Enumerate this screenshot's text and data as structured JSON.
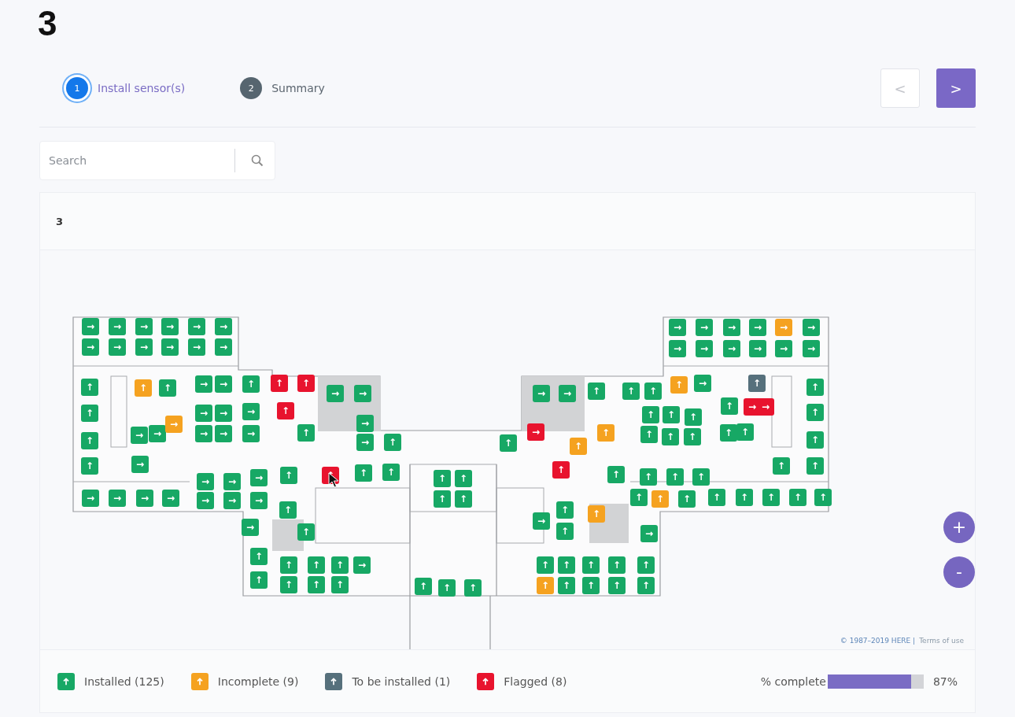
{
  "page_title": "3",
  "steps": [
    {
      "number": "1",
      "label": "Install sensor(s)",
      "selected": true
    },
    {
      "number": "2",
      "label": "Summary",
      "selected": false
    }
  ],
  "nav": {
    "prev": {
      "glyph": "<",
      "disabled": true
    },
    "next": {
      "glyph": ">",
      "disabled": false
    }
  },
  "search": {
    "placeholder": "Search"
  },
  "floor": {
    "title": "3"
  },
  "map": {
    "markers": [
      {
        "kind": "installed",
        "glyph": "→"
      },
      {
        "kind": "installed",
        "glyph": "→"
      },
      {
        "kind": "installed",
        "glyph": "→"
      },
      {
        "kind": "installed",
        "glyph": "→"
      },
      {
        "kind": "installed",
        "glyph": "→"
      },
      {
        "kind": "installed",
        "glyph": "→"
      },
      {
        "kind": "installed",
        "glyph": "→"
      },
      {
        "kind": "installed",
        "glyph": "→"
      },
      {
        "kind": "installed",
        "glyph": "→"
      },
      {
        "kind": "installed",
        "glyph": "→"
      },
      {
        "kind": "installed",
        "glyph": "→"
      },
      {
        "kind": "installed",
        "glyph": "→"
      },
      {
        "kind": "installed",
        "glyph": "↑"
      },
      {
        "kind": "installed",
        "glyph": "↑"
      },
      {
        "kind": "installed",
        "glyph": "↑"
      },
      {
        "kind": "installed",
        "glyph": "↑"
      },
      {
        "kind": "incomplete",
        "glyph": "↑"
      },
      {
        "kind": "installed",
        "glyph": "↑"
      },
      {
        "kind": "installed",
        "glyph": "→"
      },
      {
        "kind": "installed",
        "glyph": "→"
      },
      {
        "kind": "incomplete",
        "glyph": "→"
      },
      {
        "kind": "installed",
        "glyph": "→"
      },
      {
        "kind": "installed",
        "glyph": "→"
      },
      {
        "kind": "installed",
        "glyph": "→"
      },
      {
        "kind": "installed",
        "glyph": "→"
      },
      {
        "kind": "installed",
        "glyph": "→"
      },
      {
        "kind": "installed",
        "glyph": "→"
      },
      {
        "kind": "installed",
        "glyph": "→"
      },
      {
        "kind": "installed",
        "glyph": "↑"
      },
      {
        "kind": "installed",
        "glyph": "→"
      },
      {
        "kind": "installed",
        "glyph": "→"
      },
      {
        "kind": "installed",
        "glyph": "→"
      },
      {
        "kind": "installed",
        "glyph": "→"
      },
      {
        "kind": "installed",
        "glyph": "→"
      },
      {
        "kind": "installed",
        "glyph": "→"
      },
      {
        "kind": "flagged",
        "glyph": "↑"
      },
      {
        "kind": "flagged",
        "glyph": "↑"
      },
      {
        "kind": "flagged",
        "glyph": "↑"
      },
      {
        "kind": "installed",
        "glyph": "↑"
      },
      {
        "kind": "installed",
        "glyph": "→"
      },
      {
        "kind": "installed",
        "glyph": "→"
      },
      {
        "kind": "installed",
        "glyph": "→"
      },
      {
        "kind": "installed",
        "glyph": "→"
      },
      {
        "kind": "installed",
        "glyph": "↑"
      },
      {
        "kind": "installed",
        "glyph": "→"
      },
      {
        "kind": "installed",
        "glyph": "→"
      },
      {
        "kind": "installed",
        "glyph": "→"
      },
      {
        "kind": "installed",
        "glyph": "→"
      },
      {
        "kind": "installed",
        "glyph": "→"
      },
      {
        "kind": "installed",
        "glyph": "→"
      },
      {
        "kind": "installed",
        "glyph": "↑"
      },
      {
        "kind": "flagged",
        "glyph": "↑"
      },
      {
        "kind": "installed",
        "glyph": "↑"
      },
      {
        "kind": "installed",
        "glyph": "↑"
      },
      {
        "kind": "installed",
        "glyph": "↑"
      },
      {
        "kind": "installed",
        "glyph": "→"
      },
      {
        "kind": "installed",
        "glyph": "↑"
      },
      {
        "kind": "installed",
        "glyph": "↑"
      },
      {
        "kind": "installed",
        "glyph": "↑"
      },
      {
        "kind": "installed",
        "glyph": "↑"
      },
      {
        "kind": "installed",
        "glyph": "↑"
      },
      {
        "kind": "installed",
        "glyph": "↑"
      },
      {
        "kind": "installed",
        "glyph": "↑"
      },
      {
        "kind": "installed",
        "glyph": "↑"
      },
      {
        "kind": "installed",
        "glyph": "↑"
      },
      {
        "kind": "installed",
        "glyph": "→"
      },
      {
        "kind": "installed",
        "glyph": "↑"
      },
      {
        "kind": "installed",
        "glyph": "↑"
      },
      {
        "kind": "installed",
        "glyph": "↑"
      },
      {
        "kind": "installed",
        "glyph": "↑"
      },
      {
        "kind": "installed",
        "glyph": "↑"
      },
      {
        "kind": "installed",
        "glyph": "↑"
      },
      {
        "kind": "installed",
        "glyph": "↑"
      },
      {
        "kind": "installed",
        "glyph": "↑"
      },
      {
        "kind": "flagged",
        "glyph": "→"
      },
      {
        "kind": "incomplete",
        "glyph": "↑"
      },
      {
        "kind": "incomplete",
        "glyph": "↑"
      },
      {
        "kind": "flagged",
        "glyph": "↑"
      },
      {
        "kind": "installed",
        "glyph": "→"
      },
      {
        "kind": "installed",
        "glyph": "→"
      },
      {
        "kind": "installed",
        "glyph": "↑"
      },
      {
        "kind": "installed",
        "glyph": "↑"
      },
      {
        "kind": "installed",
        "glyph": "↑"
      },
      {
        "kind": "incomplete",
        "glyph": "↑"
      },
      {
        "kind": "installed",
        "glyph": "→"
      },
      {
        "kind": "installed",
        "glyph": "↑"
      },
      {
        "kind": "installed",
        "glyph": "↑"
      },
      {
        "kind": "installed",
        "glyph": "↑"
      },
      {
        "kind": "installed",
        "glyph": "↑"
      },
      {
        "kind": "installed",
        "glyph": "↑"
      },
      {
        "kind": "installed",
        "glyph": "↑"
      },
      {
        "kind": "installed",
        "glyph": "→"
      },
      {
        "kind": "installed",
        "glyph": "→"
      },
      {
        "kind": "installed",
        "glyph": "→"
      },
      {
        "kind": "installed",
        "glyph": "→"
      },
      {
        "kind": "incomplete",
        "glyph": "→"
      },
      {
        "kind": "installed",
        "glyph": "→"
      },
      {
        "kind": "installed",
        "glyph": "→"
      },
      {
        "kind": "installed",
        "glyph": "→"
      },
      {
        "kind": "installed",
        "glyph": "→"
      },
      {
        "kind": "installed",
        "glyph": "→"
      },
      {
        "kind": "installed",
        "glyph": "→"
      },
      {
        "kind": "installed",
        "glyph": "→"
      },
      {
        "kind": "to_be_installed",
        "glyph": "↑"
      },
      {
        "kind": "installed",
        "glyph": "↑"
      },
      {
        "kind": "flagged",
        "glyph": "→"
      },
      {
        "kind": "flagged",
        "glyph": "→"
      },
      {
        "kind": "installed",
        "glyph": "↑"
      },
      {
        "kind": "installed",
        "glyph": "↑"
      },
      {
        "kind": "installed",
        "glyph": "↑"
      },
      {
        "kind": "installed",
        "glyph": "↑"
      },
      {
        "kind": "installed",
        "glyph": "↑"
      },
      {
        "kind": "installed",
        "glyph": "↑"
      },
      {
        "kind": "installed",
        "glyph": "↑"
      },
      {
        "kind": "installed",
        "glyph": "↑"
      },
      {
        "kind": "installed",
        "glyph": "↑"
      },
      {
        "kind": "installed",
        "glyph": "↑"
      },
      {
        "kind": "installed",
        "glyph": "↑"
      },
      {
        "kind": "installed",
        "glyph": "↑"
      },
      {
        "kind": "incomplete",
        "glyph": "↑"
      },
      {
        "kind": "installed",
        "glyph": "↑"
      },
      {
        "kind": "installed",
        "glyph": "↑"
      },
      {
        "kind": "installed",
        "glyph": "↑"
      },
      {
        "kind": "installed",
        "glyph": "↑"
      },
      {
        "kind": "installed",
        "glyph": "↑"
      },
      {
        "kind": "installed",
        "glyph": "↑"
      },
      {
        "kind": "installed",
        "glyph": "→"
      },
      {
        "kind": "installed",
        "glyph": "↑"
      },
      {
        "kind": "installed",
        "glyph": "↑"
      },
      {
        "kind": "incomplete",
        "glyph": "↑"
      },
      {
        "kind": "installed",
        "glyph": "→"
      },
      {
        "kind": "installed",
        "glyph": "↑"
      },
      {
        "kind": "installed",
        "glyph": "↑"
      },
      {
        "kind": "installed",
        "glyph": "↑"
      },
      {
        "kind": "installed",
        "glyph": "↑"
      },
      {
        "kind": "installed",
        "glyph": "↑"
      },
      {
        "kind": "incomplete",
        "glyph": "↑"
      },
      {
        "kind": "installed",
        "glyph": "↑"
      },
      {
        "kind": "installed",
        "glyph": "↑"
      },
      {
        "kind": "installed",
        "glyph": "↑"
      },
      {
        "kind": "installed",
        "glyph": "↑"
      }
    ],
    "zoom_in": "+",
    "zoom_out": "-",
    "copyright": "© 1987–2019 HERE |",
    "terms": "Terms of use"
  },
  "legend": [
    {
      "kind": "installed",
      "label": "Installed (125)"
    },
    {
      "kind": "incomplete",
      "label": "Incomplete (9)"
    },
    {
      "kind": "to_be_installed",
      "label": "To be installed (1)"
    },
    {
      "kind": "flagged",
      "label": "Flagged (8)"
    }
  ],
  "progress": {
    "label": "% complete",
    "level": 0.87,
    "reading": "87%"
  }
}
